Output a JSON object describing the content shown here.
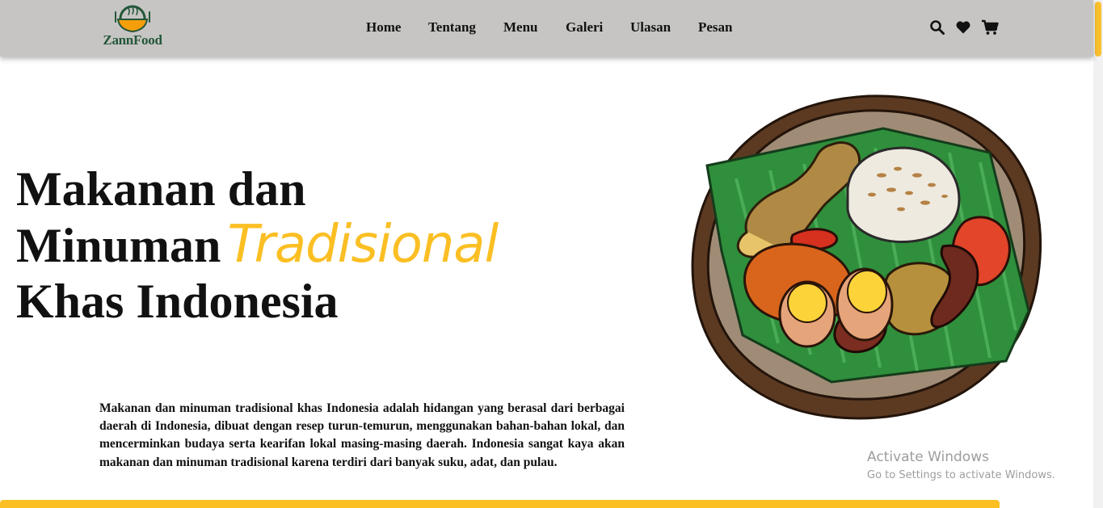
{
  "brand": {
    "name": "ZannFood"
  },
  "nav": {
    "links": [
      "Home",
      "Tentang",
      "Menu",
      "Galeri",
      "Ulasan",
      "Pesan"
    ],
    "icons": [
      "search-icon",
      "heart-icon",
      "cart-icon"
    ]
  },
  "hero": {
    "title_line1": "Makanan dan",
    "title_line2": "Minuman",
    "title_accent": "Tradisional",
    "title_line3": "Khas Indonesia",
    "description": "Makanan dan minuman tradisional khas Indonesia adalah hidangan yang berasal dari berbagai daerah di Indonesia, dibuat dengan resep turun-temurun, menggunakan bahan-bahan lokal, dan mencerminkan budaya serta kearifan lokal masing-masing daerah. Indonesia sangat kaya akan makanan dan minuman tradisional karena terdiri dari banyak suku, adat, dan pulau."
  },
  "watermark": {
    "title": "Activate Windows",
    "subtitle": "Go to Settings to activate Windows."
  },
  "colors": {
    "accent": "#fbbf24",
    "navbar": "#c6c5c3",
    "brand_green": "#24563a"
  }
}
